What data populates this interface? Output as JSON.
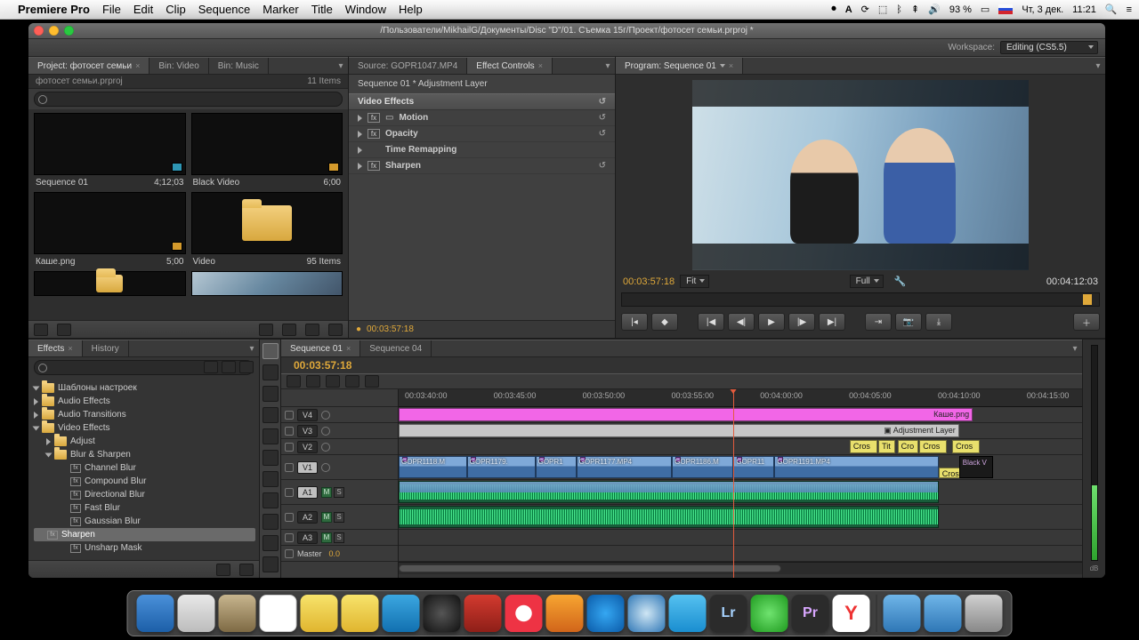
{
  "menubar": {
    "app": "Premiere Pro",
    "items": [
      "File",
      "Edit",
      "Clip",
      "Sequence",
      "Marker",
      "Title",
      "Window",
      "Help"
    ],
    "battery": "93 %",
    "date": "Чт, 3 дек.",
    "time": "11:21"
  },
  "titlebar": {
    "path": "/Пользователи/MikhailG/Документы/Disc \"D\"/01. Съемка 15г/Проект/фотосет семьи.prproj *"
  },
  "workspace": {
    "label": "Workspace:",
    "value": "Editing (CS5.5)"
  },
  "project": {
    "tabs": [
      "Project: фотосет семьи",
      "Bin: Video",
      "Bin: Music"
    ],
    "sub_left": "фотосет семьи.prproj",
    "sub_right": "11 Items",
    "search_ph": "",
    "items": [
      {
        "name": "Sequence 01",
        "meta": "4;12;03",
        "kind": "seq"
      },
      {
        "name": "Black Video",
        "meta": "6;00",
        "kind": "black"
      },
      {
        "name": "Каше.png",
        "meta": "5;00",
        "kind": "png"
      },
      {
        "name": "Video",
        "meta": "95 Items",
        "kind": "folder"
      },
      {
        "name": "",
        "meta": "",
        "kind": "folder"
      },
      {
        "name": "",
        "meta": "",
        "kind": "image"
      }
    ]
  },
  "source_tab": "Source: GOPR1047.MP4",
  "effect_controls": {
    "tab": "Effect Controls",
    "path": "Sequence 01 * Adjustment Layer",
    "section": "Video Effects",
    "rows": [
      "Motion",
      "Opacity",
      "Time Remapping",
      "Sharpen"
    ],
    "footer_tc": "00:03:57:18"
  },
  "program": {
    "tab": "Program: Sequence 01",
    "tc_left": "00:03:57:18",
    "fit": "Fit",
    "full": "Full",
    "tc_right": "00:04:12:03"
  },
  "effects": {
    "tab": "Effects",
    "tab2": "History",
    "tree": [
      {
        "lvl": 0,
        "open": true,
        "ico": "folder",
        "label": "Шаблоны настроек"
      },
      {
        "lvl": 0,
        "open": false,
        "ico": "folder",
        "label": "Audio Effects"
      },
      {
        "lvl": 0,
        "open": false,
        "ico": "folder",
        "label": "Audio Transitions"
      },
      {
        "lvl": 0,
        "open": true,
        "ico": "folder",
        "label": "Video Effects"
      },
      {
        "lvl": 1,
        "open": false,
        "ico": "folder",
        "label": "Adjust"
      },
      {
        "lvl": 1,
        "open": true,
        "ico": "folder",
        "label": "Blur & Sharpen"
      },
      {
        "lvl": 2,
        "open": null,
        "ico": "fx",
        "label": "Channel Blur"
      },
      {
        "lvl": 2,
        "open": null,
        "ico": "fx",
        "label": "Compound Blur"
      },
      {
        "lvl": 2,
        "open": null,
        "ico": "fx",
        "label": "Directional Blur"
      },
      {
        "lvl": 2,
        "open": null,
        "ico": "fx",
        "label": "Fast Blur"
      },
      {
        "lvl": 2,
        "open": null,
        "ico": "fx",
        "label": "Gaussian Blur"
      },
      {
        "lvl": 2,
        "open": null,
        "ico": "fx",
        "label": "Sharpen",
        "sel": true
      },
      {
        "lvl": 2,
        "open": null,
        "ico": "fx",
        "label": "Unsharp Mask"
      }
    ]
  },
  "timeline": {
    "tabs": [
      "Sequence 01",
      "Sequence 04"
    ],
    "tc": "00:03:57:18",
    "ruler": [
      "00:03:40:00",
      "00:03:45:00",
      "00:03:50:00",
      "00:03:55:00",
      "00:04:00:00",
      "00:04:05:00",
      "00:04:10:00",
      "00:04:15:00"
    ],
    "tracks": {
      "v4": "V4",
      "v3": "V3",
      "v2": "V2",
      "v1": "V1",
      "a1": "A1",
      "a2": "A2",
      "a3": "A3",
      "master": "Master",
      "master_val": "0.0"
    },
    "clips": {
      "v4_label": "Каше.png",
      "v3_label": "Adjustment Layer",
      "v2_labels": [
        "Cros",
        "Tit",
        "Cro",
        "Cros",
        "Cros"
      ],
      "v1_labels": [
        "GOPR1118.M",
        "GOPR1179.",
        "GOPR1",
        "GOPR1177.MP4",
        "GOPR1186.M",
        "GOPR11",
        "GOPR1191.MP4"
      ],
      "v1_tail": "Black V",
      "v1_crossd": "Cross D"
    }
  },
  "colors": {
    "accent": "#e0a93a",
    "pink": "#f266e7",
    "blue": "#6d94c8",
    "green": "#1fae5f",
    "title": "#e9e06c"
  }
}
